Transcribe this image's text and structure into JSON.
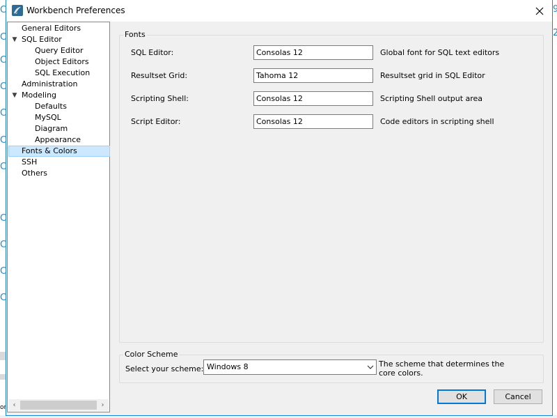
{
  "dialog": {
    "title": "Workbench Preferences"
  },
  "tree": {
    "items": [
      {
        "label": "General Editors",
        "level": 1,
        "expander": false
      },
      {
        "label": "SQL Editor",
        "level": 1,
        "expander": true
      },
      {
        "label": "Query Editor",
        "level": 2,
        "expander": false
      },
      {
        "label": "Object Editors",
        "level": 2,
        "expander": false
      },
      {
        "label": "SQL Execution",
        "level": 2,
        "expander": false
      },
      {
        "label": "Administration",
        "level": 1,
        "expander": false
      },
      {
        "label": "Modeling",
        "level": 1,
        "expander": true
      },
      {
        "label": "Defaults",
        "level": 2,
        "expander": false
      },
      {
        "label": "MySQL",
        "level": 2,
        "expander": false
      },
      {
        "label": "Diagram",
        "level": 2,
        "expander": false
      },
      {
        "label": "Appearance",
        "level": 2,
        "expander": false
      },
      {
        "label": "Fonts & Colors",
        "level": 1,
        "expander": false,
        "selected": true
      },
      {
        "label": "SSH",
        "level": 1,
        "expander": false
      },
      {
        "label": "Others",
        "level": 1,
        "expander": false
      }
    ]
  },
  "fonts": {
    "group_label": "Fonts",
    "rows": [
      {
        "label": "SQL Editor:",
        "value": "Consolas 12",
        "desc": "Global font for SQL text editors"
      },
      {
        "label": "Resultset Grid:",
        "value": "Tahoma 12",
        "desc": "Resultset grid in SQL Editor"
      },
      {
        "label": "Scripting Shell:",
        "value": "Consolas 12",
        "desc": "Scripting Shell output area"
      },
      {
        "label": "Script Editor:",
        "value": "Consolas 12",
        "desc": "Code editors in scripting shell"
      }
    ]
  },
  "color_scheme": {
    "group_label": "Color Scheme",
    "select_label": "Select your scheme:",
    "selected": "Windows 8",
    "desc": "The scheme that determines the core colors."
  },
  "buttons": {
    "ok": "OK",
    "cancel": "Cancel"
  },
  "colors": {
    "accent": "#1883d7",
    "selection": "#cce8ff",
    "bg_text": "#1e8ac8"
  },
  "background": {
    "left_glyphs": [
      "C",
      "C",
      "C",
      "C",
      "C",
      "C",
      "C",
      "C",
      "C",
      "C",
      "C"
    ],
    "right_glyphs": [
      "9",
      "2"
    ],
    "bottom_left": "on"
  }
}
